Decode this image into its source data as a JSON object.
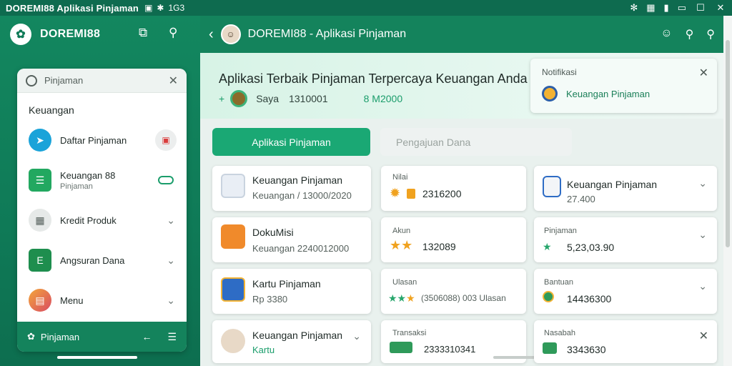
{
  "status_bar": {
    "title": "DOREMI88 Aplikasi Pinjaman",
    "icons": [
      "sim-icon",
      "wifi-icon",
      "1G 3"
    ],
    "right_text": "1G3"
  },
  "sidebar": {
    "app_name": "DOREMI88",
    "search_placeholder": "Pinjaman",
    "section_title": "Keuangan",
    "items": [
      {
        "label": "Daftar Pinjaman",
        "sub": "",
        "icon": "send-icon",
        "color": "#1aa3d9"
      },
      {
        "label": "Keuangan 88",
        "sub": "Pinjaman",
        "icon": "document-icon",
        "color": "#22a860"
      },
      {
        "label": "Kredit Produk",
        "sub": "",
        "icon": "calculator-icon",
        "color": "#e6e9e8"
      },
      {
        "label": "Angsuran Dana",
        "sub": "",
        "icon": "excel-icon",
        "color": "#1e8e4e"
      },
      {
        "label": "Menu",
        "sub": "",
        "icon": "apps-icon",
        "color": "#e2574c"
      }
    ],
    "bottom_label": "Pinjaman"
  },
  "main_header": {
    "title": "DOREMI88 - Aplikasi Pinjaman"
  },
  "hero": {
    "title": "Aplikasi Terbaik Pinjaman Terpercaya Keuangan Anda",
    "meta_left": "Saya",
    "meta_amount": "1310001",
    "meta_right": "8 M2000"
  },
  "notice": {
    "title": "Notifikasi",
    "text": "Keuangan Pinjaman"
  },
  "tabs": {
    "primary": "Aplikasi Pinjaman",
    "secondary": "Pengajuan Dana"
  },
  "cards": {
    "left": [
      {
        "title": "Keuangan Pinjaman",
        "sub": "Keuangan / 13000/2020",
        "icon": "screen-icon"
      },
      {
        "title": "DokuMisi",
        "sub": "Keuangan 2240012000",
        "icon": "briefcase-icon"
      },
      {
        "title": "Kartu Pinjaman",
        "sub": "Rp 3380",
        "icon": "chart-icon"
      },
      {
        "title": "Keuangan Pinjaman",
        "sub": "Kartu",
        "icon": "person-icon"
      }
    ],
    "middle": [
      {
        "label": "Nilai",
        "value": "2316200"
      },
      {
        "label": "Akun",
        "value": "132089"
      },
      {
        "label": "Ulasan",
        "value": "(3506088) 003 Ulasan"
      },
      {
        "label": "Transaksi",
        "value": "2333310341"
      }
    ],
    "right": [
      {
        "title": "Keuangan Pinjaman",
        "value": "27.400"
      },
      {
        "label": "Pinjaman",
        "value": "5,23,03.90"
      },
      {
        "label": "Bantuan",
        "value": "14436300"
      },
      {
        "label": "Nasabah",
        "value": "3343630"
      }
    ]
  }
}
